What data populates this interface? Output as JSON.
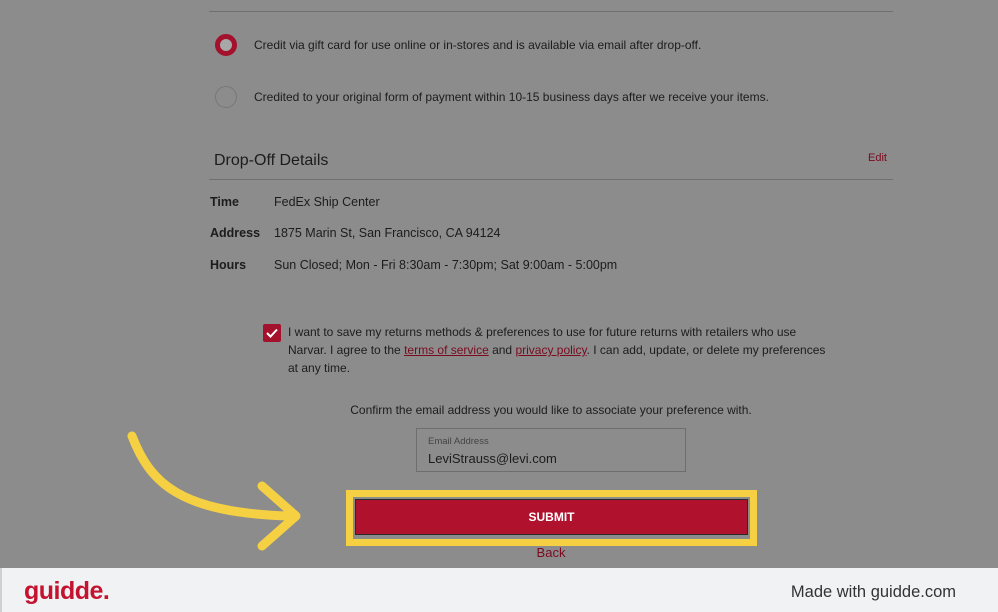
{
  "refund_options": [
    {
      "label": "Credit via gift card for use online or in-stores and is available via email after drop-off.",
      "selected": true
    },
    {
      "label": "Credited to your original form of payment within 10-15 business days after we receive your items.",
      "selected": false
    }
  ],
  "dropoff": {
    "title": "Drop-Off Details",
    "edit_label": "Edit",
    "rows": [
      {
        "label": "Time",
        "value": "FedEx Ship Center"
      },
      {
        "label": "Address",
        "value": "1875 Marin St, San Francisco, CA 94124"
      },
      {
        "label": "Hours",
        "value": "Sun Closed; Mon - Fri 8:30am - 7:30pm; Sat 9:00am - 5:00pm"
      }
    ]
  },
  "consent": {
    "checked": true,
    "text_before": "I want to save my returns methods & preferences to use for future returns with retailers who use Narvar. I agree to the ",
    "terms_label": "terms of service",
    "text_and": " and ",
    "privacy_label": "privacy policy",
    "text_after": ". I can add, update, or delete my preferences at any time."
  },
  "email": {
    "prompt": "Confirm the email address you would like to associate your preference with.",
    "label": "Email Address",
    "value": "LeviStrauss@levi.com"
  },
  "submit_label": "SUBMIT",
  "back_label": "Back",
  "footer": {
    "logo": "guidde.",
    "made_with": "Made with guidde.com"
  },
  "colors": {
    "accent": "#b0122e",
    "highlight": "#f5d043",
    "overlay": "#8c8c8c"
  }
}
